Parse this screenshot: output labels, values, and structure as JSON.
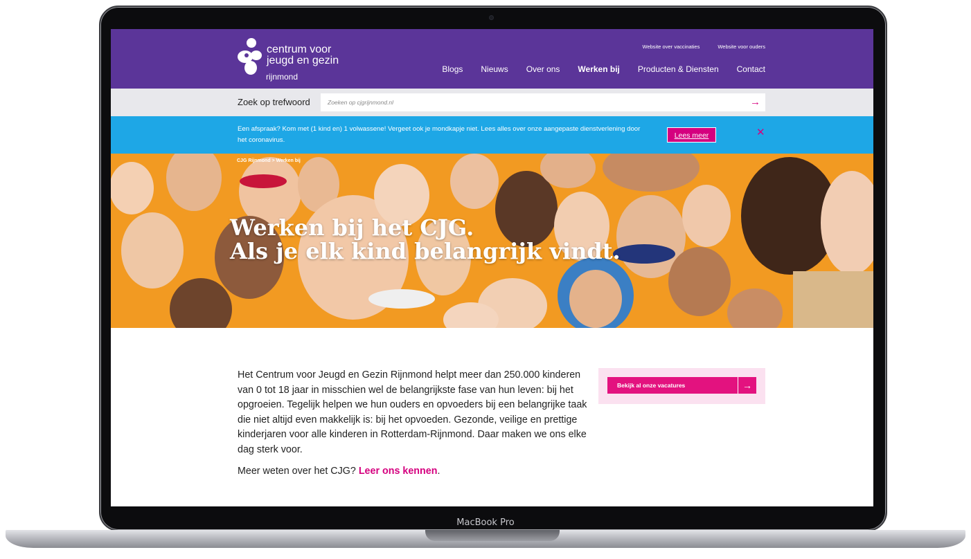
{
  "header": {
    "logo_line1": "centrum voor",
    "logo_line2": "jeugd en gezin",
    "logo_sub": "rijnmond",
    "top_links": [
      "Website over vaccinaties",
      "Website voor ouders"
    ],
    "nav": [
      {
        "label": "Blogs",
        "active": false
      },
      {
        "label": "Nieuws",
        "active": false
      },
      {
        "label": "Over ons",
        "active": false
      },
      {
        "label": "Werken bij",
        "active": true
      },
      {
        "label": "Producten & Diensten",
        "active": false
      },
      {
        "label": "Contact",
        "active": false
      }
    ]
  },
  "search": {
    "label": "Zoek op trefwoord",
    "placeholder": "Zoeken op cjgrijnmond.nl",
    "button_icon": "arrow-right-icon"
  },
  "alert": {
    "text": "Een afspraak? Kom met (1 kind en) 1 volwassene! Vergeet ook je mondkapje niet. Lees alles over onze aangepaste dienstverlening door het coronavirus.",
    "button": "Lees meer",
    "close_icon": "close-icon"
  },
  "hero": {
    "breadcrumb": "CJG Rijnmond > Werken bij",
    "title_line1": "Werken bij het CJG.",
    "title_line2": "Als je elk kind belangrijk vindt."
  },
  "content": {
    "paragraph": "Het Centrum voor Jeugd en Gezin Rijnmond helpt meer dan 250.000 kinderen van 0 tot 18 jaar in misschien wel de belangrijkste fase van hun leven: bij het opgroeien. Tegelijk helpen we hun ouders en opvoeders bij een belangrijke taak die niet altijd even makkelijk is: bij het opvoeden. Gezonde, veilige en prettige kinderjaren voor alle kinderen in Rotterdam-Rijnmond. Daar maken we ons elke dag sterk voor.",
    "more_prefix": "Meer weten over het CJG?",
    "more_link": "Leer ons kennen",
    "more_suffix": ".",
    "vacature_button": "Bekijk al onze vacatures"
  },
  "device": {
    "label": "MacBook Pro"
  },
  "colors": {
    "brand_purple": "#5b3599",
    "brand_pink": "#d5007f",
    "alert_blue": "#1ea7e6",
    "hero_orange": "#f29a22"
  }
}
